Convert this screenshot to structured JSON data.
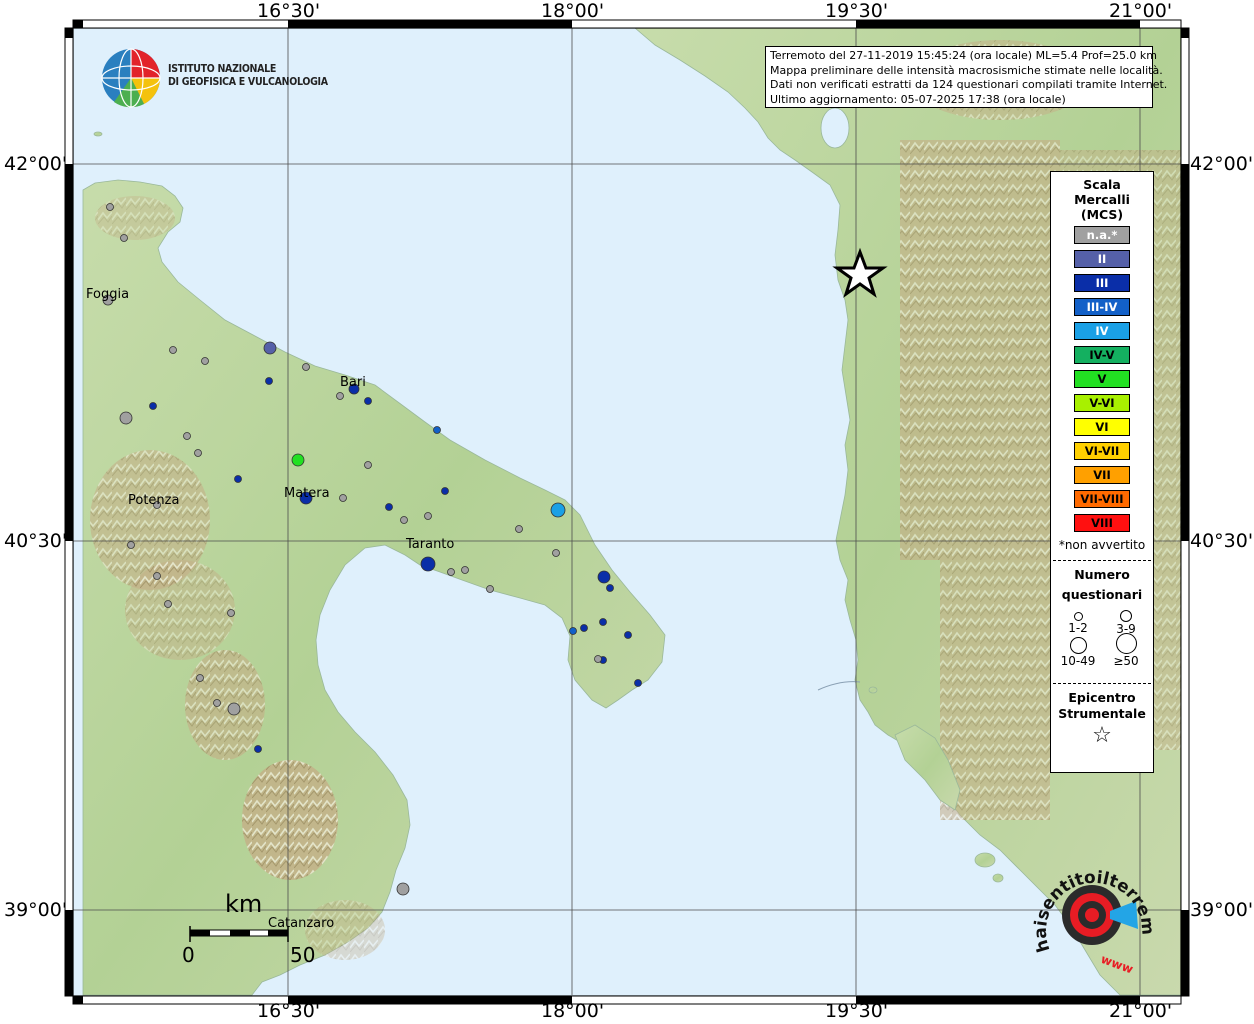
{
  "axes": {
    "top_ticks": [
      "16°30'",
      "18°00'",
      "19°30'",
      "21°00'"
    ],
    "bottom_ticks": [
      "16°30'",
      "18°00'",
      "19°30'",
      "21°00'"
    ],
    "left_ticks": [
      "42°00'",
      "40°30'",
      "39°00'"
    ],
    "right_ticks": [
      "42°00'",
      "40°30'",
      "39°00'"
    ]
  },
  "info": {
    "line1": "Terremoto del 27-11-2019 15:45:24 (ora locale) ML=5.4 Prof=25.0 km",
    "line2": "Mappa preliminare delle intensità macrosismiche stimate nelle località.",
    "line3": "Dati non verificati estratti da 124 questionari compilati tramite Internet.",
    "line4": "Ultimo aggiornamento: 05-07-2025 17:38 (ora locale)"
  },
  "logo": {
    "line1": "ISTITUTO NAZIONALE",
    "line2": "DI GEOFISICA E VULCANOLOGIA"
  },
  "legend": {
    "title": "Scala\nMercalli\n(MCS)",
    "scale": [
      {
        "label": "n.a.*",
        "color": "#a0a0a0",
        "text_color": "#ffffff"
      },
      {
        "label": "II",
        "color": "#5560a8",
        "text_color": "#ffffff"
      },
      {
        "label": "III",
        "color": "#0a2ea8",
        "text_color": "#ffffff"
      },
      {
        "label": "III-IV",
        "color": "#1260c8",
        "text_color": "#ffffff"
      },
      {
        "label": "IV",
        "color": "#1aa0e6",
        "text_color": "#ffffff"
      },
      {
        "label": "IV-V",
        "color": "#14b060",
        "text_color": "#000000"
      },
      {
        "label": "V",
        "color": "#22e022",
        "text_color": "#000000"
      },
      {
        "label": "V-VI",
        "color": "#a8f000",
        "text_color": "#000000"
      },
      {
        "label": "VI",
        "color": "#ffff00",
        "text_color": "#000000"
      },
      {
        "label": "VI-VII",
        "color": "#ffd000",
        "text_color": "#000000"
      },
      {
        "label": "VII",
        "color": "#ffa000",
        "text_color": "#000000"
      },
      {
        "label": "VII-VIII",
        "color": "#ff6a00",
        "text_color": "#000000"
      },
      {
        "label": "VIII",
        "color": "#ff1010",
        "text_color": "#000000"
      }
    ],
    "note": "*non avvertito",
    "count_title": "Numero",
    "count_title2": "questionari",
    "sizes": [
      "1-2",
      "3-9",
      "10-49",
      "≥50"
    ],
    "epicenter_title": "Epicentro",
    "epicenter_title2": "Strumentale"
  },
  "cities": {
    "foggia": "Foggia",
    "bari": "Bari",
    "potenza": "Potenza",
    "matera": "Matera",
    "taranto": "Taranto",
    "catanzaro": "Catanzaro"
  },
  "scale_bar": {
    "unit": "km",
    "zero": "0",
    "fifty": "50"
  },
  "sentito": {
    "brand": "haisentitoilterremoto.it",
    "url": "www"
  },
  "points": [
    {
      "name": "foggia-area-1",
      "c": "na",
      "s": 1
    },
    {
      "name": "foggia-area-2",
      "c": "na",
      "s": 1
    }
  ]
}
